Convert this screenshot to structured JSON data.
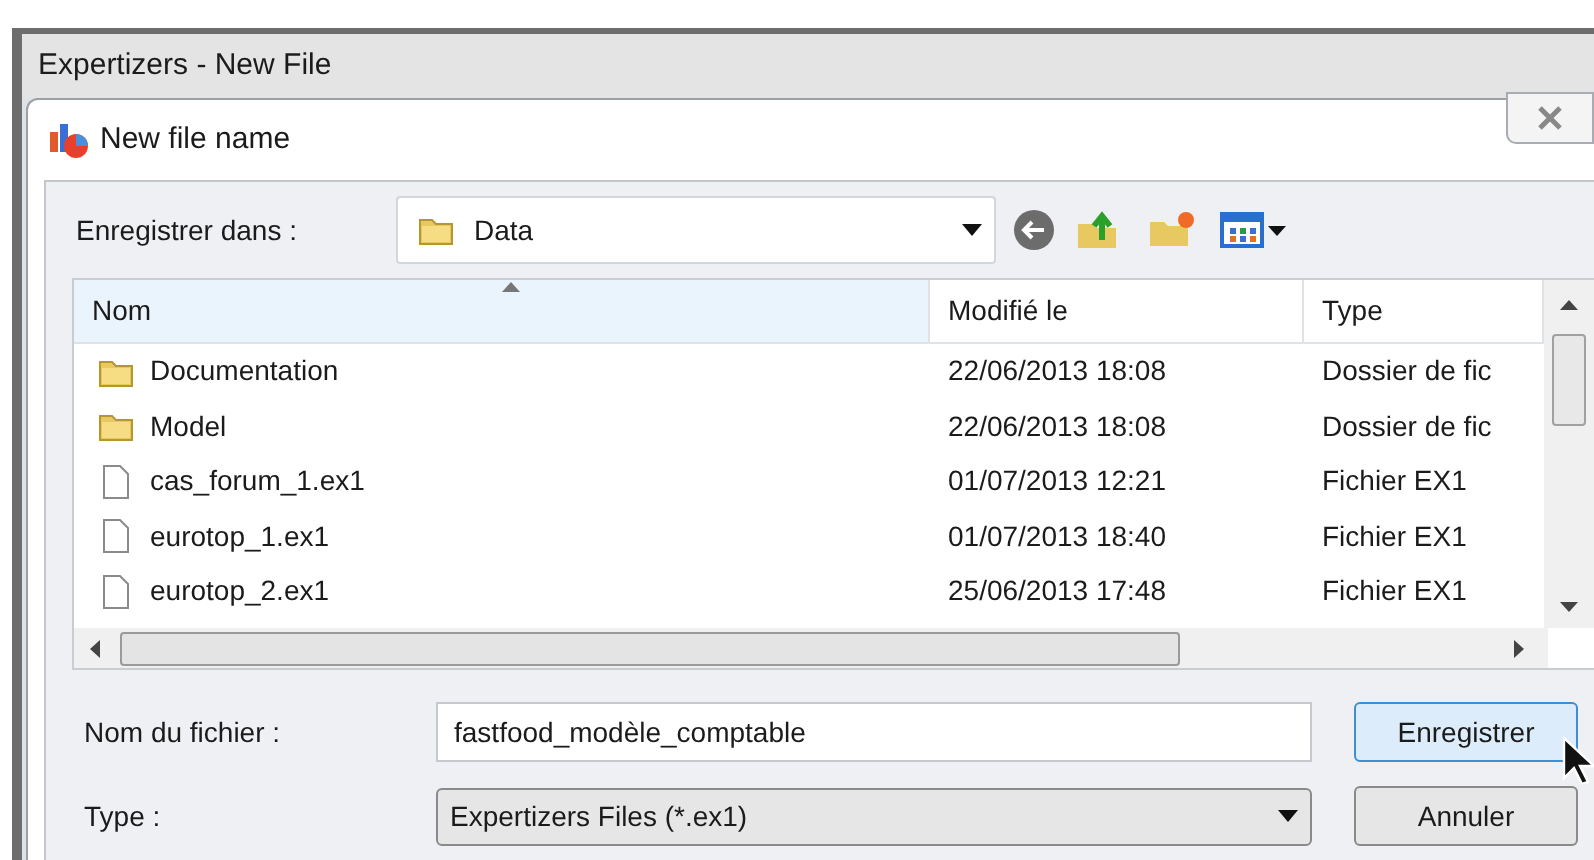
{
  "window": {
    "title": "Expertizers - New File"
  },
  "dialog": {
    "title": "New file name"
  },
  "location": {
    "label": "Enregistrer dans :",
    "value": "Data"
  },
  "table": {
    "columns": [
      {
        "label": "Nom",
        "sorted": true
      },
      {
        "label": "Modifié le",
        "sorted": false
      },
      {
        "label": "Type",
        "sorted": false
      }
    ],
    "rows": [
      {
        "kind": "folder",
        "name": "Documentation",
        "modified": "22/06/2013 18:08",
        "type": "Dossier de fic"
      },
      {
        "kind": "folder",
        "name": "Model",
        "modified": "22/06/2013 18:08",
        "type": "Dossier de fic"
      },
      {
        "kind": "file",
        "name": "cas_forum_1.ex1",
        "modified": "01/07/2013 12:21",
        "type": "Fichier EX1"
      },
      {
        "kind": "file",
        "name": "eurotop_1.ex1",
        "modified": "01/07/2013 18:40",
        "type": "Fichier EX1"
      },
      {
        "kind": "file",
        "name": "eurotop_2.ex1",
        "modified": "25/06/2013 17:48",
        "type": "Fichier EX1"
      }
    ]
  },
  "filename": {
    "label": "Nom du fichier :",
    "value": "fastfood_modèle_comptable"
  },
  "filetype": {
    "label": "Type :",
    "value": "Expertizers Files (*.ex1)"
  },
  "buttons": [
    {
      "label": "Enregistrer",
      "default": true
    },
    {
      "label": "Annuler",
      "default": false
    }
  ]
}
